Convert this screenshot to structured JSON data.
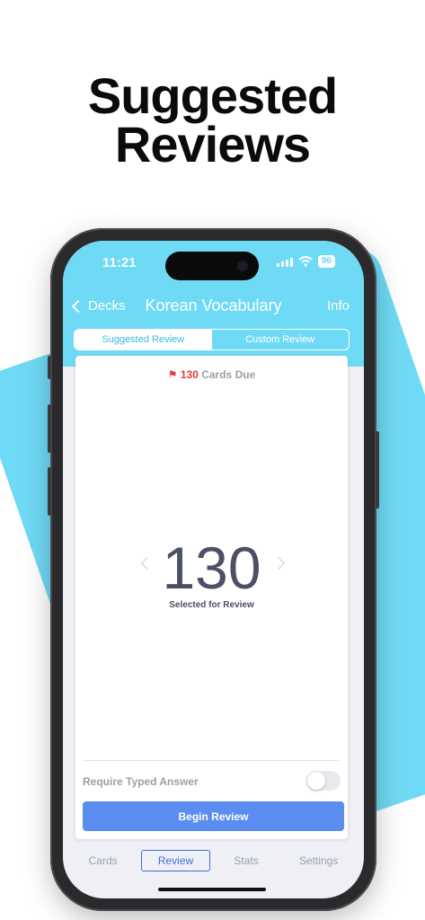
{
  "headline": {
    "line1": "Suggested",
    "line2": "Reviews"
  },
  "status_bar": {
    "time": "11:21",
    "battery": "96"
  },
  "nav": {
    "back_label": "Decks",
    "title": "Korean Vocabulary",
    "info_label": "Info"
  },
  "segmented": {
    "suggested": "Suggested Review",
    "custom": "Custom Review",
    "selected": "Suggested Review"
  },
  "card": {
    "due_count": "130",
    "due_label": "Cards Due",
    "selected_count": "130",
    "selected_label": "Selected for Review",
    "typed_answer_label": "Require Typed Answer",
    "typed_answer_enabled": false,
    "begin_label": "Begin Review"
  },
  "tabs": [
    {
      "label": "Cards"
    },
    {
      "label": "Review"
    },
    {
      "label": "Stats"
    },
    {
      "label": "Settings"
    }
  ],
  "active_tab": "Review",
  "colors": {
    "accent_cyan": "#6fdaf5",
    "primary_blue": "#5a8def",
    "alert_red": "#e53935"
  }
}
